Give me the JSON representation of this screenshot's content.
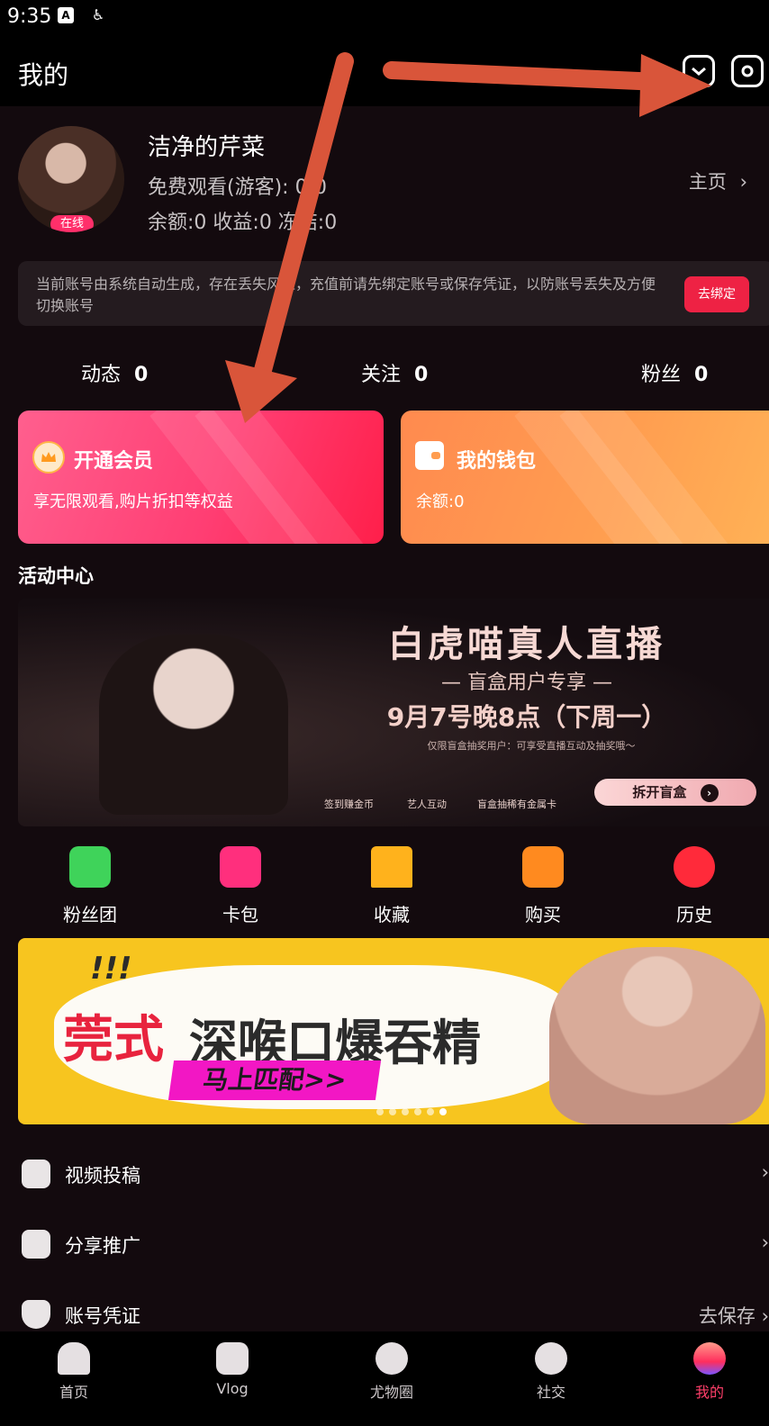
{
  "status_bar": {
    "time": "9:35"
  },
  "header": {
    "title": "我的"
  },
  "profile": {
    "name": "洁净的芹菜",
    "free_watch": "免费观看(游客): 0/0",
    "balance_line": "余额:0 收益:0 冻结:0",
    "online_badge": "在线",
    "home_link": "主页"
  },
  "notice": {
    "text": "当前账号由系统自动生成，存在丢失风险，充值前请先绑定账号或保存凭证，以防账号丢失及方便切换账号",
    "button": "去绑定"
  },
  "stats": [
    {
      "label": "动态",
      "value": "0"
    },
    {
      "label": "关注",
      "value": "0"
    },
    {
      "label": "粉丝",
      "value": "0"
    }
  ],
  "cards": {
    "vip": {
      "title": "开通会员",
      "subtitle": "享无限观看,购片折扣等权益"
    },
    "wallet": {
      "title": "我的钱包",
      "subtitle": "余额:0"
    }
  },
  "activity": {
    "title": "活动中心",
    "banner1": {
      "headline": "白虎喵真人直播",
      "sub": "— 盲盒用户专享 —",
      "date": "9月7号晚8点（下周一）",
      "note": "仅限盲盒抽奖用户：可享受直播互动及抽奖哦～",
      "feature1": "签到赚金币",
      "feature2": "艺人互动",
      "feature3": "盲盒抽稀有金属卡",
      "cta": "拆开盲盒"
    }
  },
  "quick_menu": [
    {
      "label": "粉丝团",
      "icon": "fan-group-icon",
      "color": "#3fd35a"
    },
    {
      "label": "卡包",
      "icon": "coupon-icon",
      "color": "#ff2f7d"
    },
    {
      "label": "收藏",
      "icon": "favorite-icon",
      "color": "#ffb21c"
    },
    {
      "label": "购买",
      "icon": "shopping-bag-icon",
      "color": "#ff8a1f"
    },
    {
      "label": "历史",
      "icon": "history-clock-icon",
      "color": "#ff2a3a"
    }
  ],
  "banner2": {
    "exclaim": "!!!",
    "red_text": "莞式",
    "black_text": "深喉口爆吞精",
    "cta": "马上匹配>>"
  },
  "list": [
    {
      "label": "视频投稿",
      "icon": "upload-icon",
      "right": "›"
    },
    {
      "label": "分享推广",
      "icon": "share-icon",
      "right": "›"
    },
    {
      "label": "账号凭证",
      "icon": "shield-icon",
      "right": "去保存 ›"
    }
  ],
  "bottom_nav": [
    {
      "label": "首页",
      "icon": "home-icon"
    },
    {
      "label": "Vlog",
      "icon": "play-icon"
    },
    {
      "label": "尤物圈",
      "icon": "heart-circle-icon"
    },
    {
      "label": "社交",
      "icon": "planet-icon"
    },
    {
      "label": "我的",
      "icon": "profile-icon",
      "active": true
    }
  ],
  "colors": {
    "accent": "#ff3f6a",
    "arrow": "#d9553a",
    "background": "#130a0e"
  }
}
